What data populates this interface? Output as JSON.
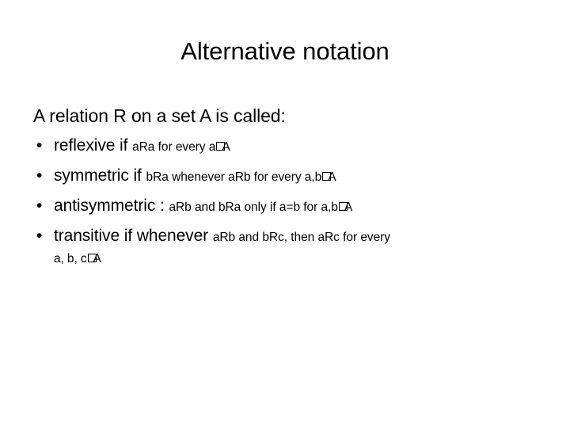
{
  "slide": {
    "title": "Alternative notation",
    "intro": "A relation R on a set A is called:",
    "bullet_marker": "•",
    "missing_glyph_note": "tofu-box",
    "set_name": "A",
    "bullets": [
      {
        "lead": "reflexive if",
        "tail": "aRa for every a",
        "set": "A",
        "wrap": ""
      },
      {
        "lead": "symmetric if",
        "tail": "bRa whenever aRb for every a,b",
        "set": "A",
        "wrap": ""
      },
      {
        "lead": "antisymmetric :",
        "tail": "aRb and bRa only if a=b for a,b",
        "set": "A",
        "wrap": ""
      },
      {
        "lead": "transitive if whenever",
        "tail": "aRb and bRc, then aRc for every",
        "set": "A",
        "wrap": "a, b, c"
      }
    ]
  },
  "colors": {
    "background": "#ffffff",
    "text": "#000000"
  }
}
